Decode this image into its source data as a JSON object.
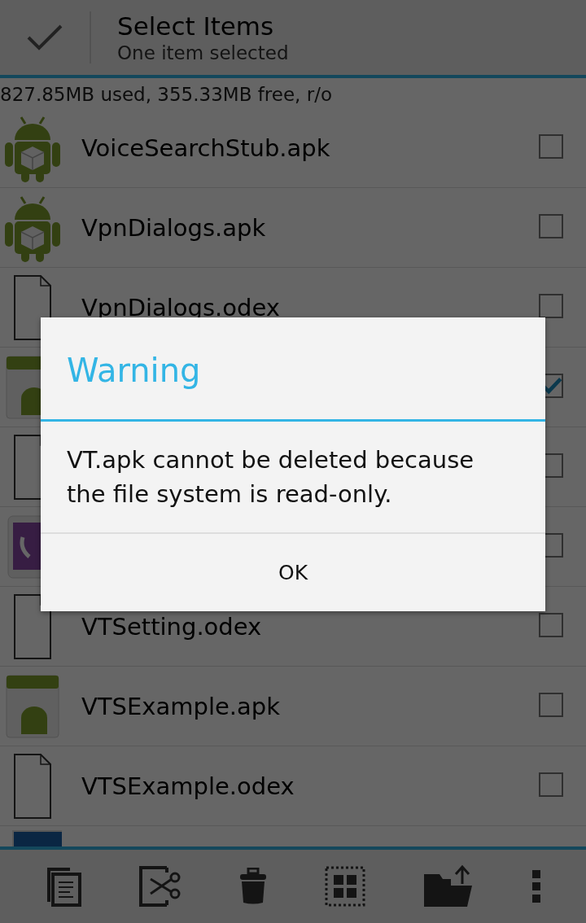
{
  "action_bar": {
    "title": "Select Items",
    "subtitle": "One item selected"
  },
  "storage_info": "827.85MB used, 355.33MB free, r/o",
  "files": [
    {
      "name": "VoiceSearchStub.apk",
      "kind": "robot",
      "checked": false
    },
    {
      "name": "VpnDialogs.apk",
      "kind": "robot",
      "checked": false
    },
    {
      "name": "VpnDialogs.odex",
      "kind": "file",
      "checked": false
    },
    {
      "kind": "apk",
      "checked": true
    },
    {
      "kind": "file",
      "checked": false
    },
    {
      "kind": "phone",
      "checked": false
    },
    {
      "name": "VTSetting.odex",
      "kind": "file",
      "checked": false
    },
    {
      "name": "VTSExample.apk",
      "kind": "apk",
      "checked": false
    },
    {
      "name": "VTSExample.odex",
      "kind": "file",
      "checked": false
    },
    {
      "kind": "blue"
    }
  ],
  "dialog": {
    "title": "Warning",
    "message": "VT.apk cannot be deleted because the file system is read-only.",
    "button": "OK"
  }
}
